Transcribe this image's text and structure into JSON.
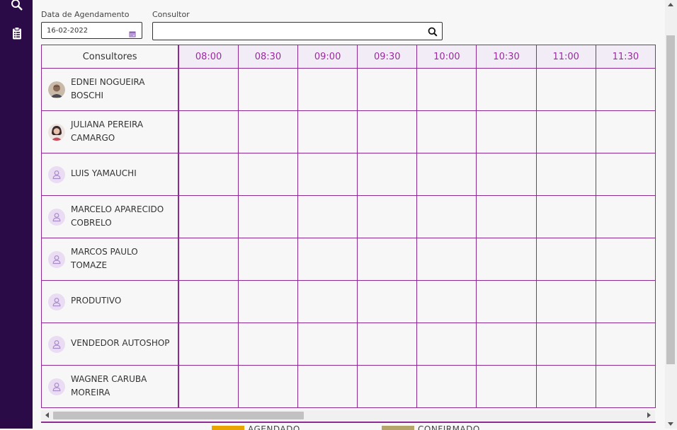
{
  "filters": {
    "date_label": "Data de Agendamento",
    "date_value": "16-02-2022",
    "consultor_label": "Consultor",
    "consultor_value": "",
    "consultor_placeholder": ""
  },
  "schedule": {
    "header_label": "Consultores",
    "times": [
      "08:00",
      "08:30",
      "09:00",
      "09:30",
      "10:00",
      "10:30",
      "11:00",
      "11:30"
    ],
    "consultants": [
      {
        "name": "EDNEI NOGUEIRA BOSCHI",
        "avatar": "photo-man"
      },
      {
        "name": "JULIANA PEREIRA CAMARGO",
        "avatar": "photo-woman"
      },
      {
        "name": "LUIS YAMAUCHI",
        "avatar": "user-icon"
      },
      {
        "name": "MARCELO APARECIDO COBRELO",
        "avatar": "user-icon"
      },
      {
        "name": "MARCOS PAULO TOMAZE",
        "avatar": "user-icon"
      },
      {
        "name": "PRODUTIVO",
        "avatar": "user-icon"
      },
      {
        "name": "VENDEDOR AUTOSHOP",
        "avatar": "user-icon"
      },
      {
        "name": "WAGNER CARUBA MOREIRA",
        "avatar": "user-icon"
      }
    ]
  },
  "legend": {
    "items": [
      {
        "label": "AGENDADO",
        "color": "#e8a400"
      },
      {
        "label": "CONFIRMADO",
        "color": "#b5a56a"
      }
    ]
  },
  "colors": {
    "sidebar": "#2a0a47",
    "grid_line": "#8e2b92",
    "time_text": "#9a2aa0"
  }
}
